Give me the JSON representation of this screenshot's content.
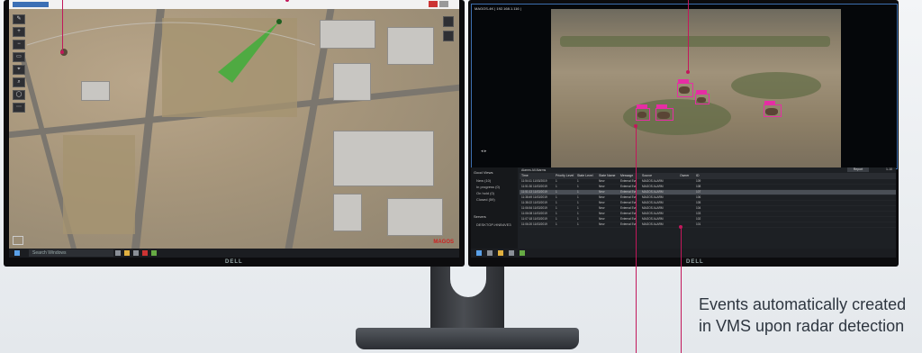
{
  "left_screen": {
    "search_placeholder": "Search Windows",
    "tools": [
      "✎",
      "+",
      "−",
      "▭",
      "⌖",
      "⌕",
      "◯",
      "⋯"
    ],
    "logo_text": "MAGOS",
    "brand": "DELL"
  },
  "right_screen": {
    "camera_title": "MAGOS-4K | 192.168.1.116 |",
    "sidebar": {
      "title": "Good Views",
      "items": [
        "New (10)",
        "In progress (0)",
        "On hold (0)",
        "Closed (59)"
      ],
      "servers_title": "Servers",
      "server": "DESKTOP-HNB4VE3"
    },
    "filter": {
      "label": "Alarms",
      "value": "All Alarms"
    },
    "table_headers": [
      "Time",
      "Priority Level",
      "State Level",
      "State Name",
      "Message",
      "Source",
      "Owner",
      "ID"
    ],
    "rows": [
      [
        "11:54:11 11/03/2019",
        "1",
        "1",
        "New",
        "External Eve",
        "MAGOS ALARM",
        "",
        "109"
      ],
      [
        "11:51:30 11/03/2019",
        "1",
        "1",
        "New",
        "External Eve",
        "MAGOS ALARM",
        "",
        "108"
      ],
      [
        "11:51:13 11/03/2019",
        "1",
        "1",
        "New",
        "External Eve",
        "MAGOS ALARM",
        "",
        "107"
      ],
      [
        "11:38:49 11/03/2019",
        "1",
        "1",
        "New",
        "External Eve",
        "MAGOS ALARM",
        "",
        "106"
      ],
      [
        "11:38:22 11/03/2019",
        "1",
        "1",
        "New",
        "External Eve",
        "MAGOS ALARM",
        "",
        "105"
      ],
      [
        "11:06:54 11/03/2019",
        "1",
        "1",
        "New",
        "External Eve",
        "MAGOS ALARM",
        "",
        "104"
      ],
      [
        "11:06:08 11/03/2019",
        "1",
        "1",
        "New",
        "External Eve",
        "MAGOS ALARM",
        "",
        "103"
      ],
      [
        "11:07:18 11/03/2019",
        "1",
        "1",
        "New",
        "External Eve",
        "MAGOS ALARM",
        "",
        "102"
      ],
      [
        "11:06:20 11/03/2019",
        "1",
        "1",
        "New",
        "External Eve",
        "MAGOS ALARM",
        "",
        "101"
      ]
    ],
    "report_button": "Report",
    "page_info": "1-10",
    "brand": "DELL"
  },
  "caption": {
    "line1": "Events automatically created",
    "line2": "in VMS upon radar detection"
  },
  "colors": {
    "accent": "#c2185b",
    "detection": "#e62da4",
    "radar_sector": "#3fae3a"
  }
}
